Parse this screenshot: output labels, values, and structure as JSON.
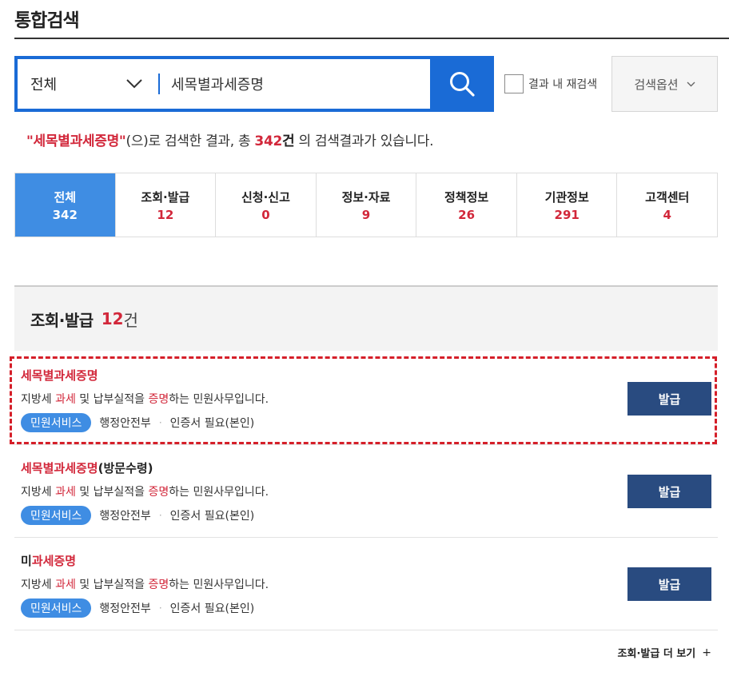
{
  "page": {
    "title": "통합검색"
  },
  "search": {
    "scope_selected": "전체",
    "query": "세목별과세증명",
    "re_search_label": "결과 내 재검색",
    "options_label": "검색옵션"
  },
  "summary": {
    "query_quoted": "\"세목별과세증명\"",
    "text_after_query": "(으)로 검색한 결과, 총",
    "total_count": "342",
    "count_unit": "건",
    "text_end": "의 검색결과가 있습니다."
  },
  "tabs": [
    {
      "name": "전체",
      "count": "342"
    },
    {
      "name": "조회·발급",
      "count": "12"
    },
    {
      "name": "신청·신고",
      "count": "0"
    },
    {
      "name": "정보·자료",
      "count": "9"
    },
    {
      "name": "정책정보",
      "count": "26"
    },
    {
      "name": "기관정보",
      "count": "291"
    },
    {
      "name": "고객센터",
      "count": "4"
    }
  ],
  "section": {
    "title": "조회·발급",
    "count": "12",
    "unit": "건"
  },
  "results": [
    {
      "title_highlight": "세목별과세증명",
      "title_rest": "",
      "desc_parts": [
        "지방세 ",
        "과세",
        " 및 납부실적을 ",
        "증명",
        "하는 민원사무입니다."
      ],
      "badge": "민원서비스",
      "org": "행정안전부",
      "cert": "인증서 필요(본인)",
      "button": "발급"
    },
    {
      "title_highlight": "세목별과세증명",
      "title_rest": "(방문수령)",
      "desc_parts": [
        "지방세 ",
        "과세",
        " 및 납부실적을 ",
        "증명",
        "하는 민원사무입니다."
      ],
      "badge": "민원서비스",
      "org": "행정안전부",
      "cert": "인증서 필요(본인)",
      "button": "발급"
    },
    {
      "title_prefix": "미",
      "title_highlight": "과세증명",
      "title_rest": "",
      "desc_parts": [
        "지방세 ",
        "과세",
        " 및 납부실적을 ",
        "증명",
        "하는 민원사무입니다."
      ],
      "badge": "민원서비스",
      "org": "행정안전부",
      "cert": "인증서 필요(본인)",
      "button": "발급"
    }
  ],
  "more_link": "조회·발급 더 보기",
  "colors": {
    "accent_blue": "#1a6bd6",
    "tab_active": "#3f8de3",
    "highlight_red": "#d2273a",
    "button_navy": "#294b80"
  }
}
